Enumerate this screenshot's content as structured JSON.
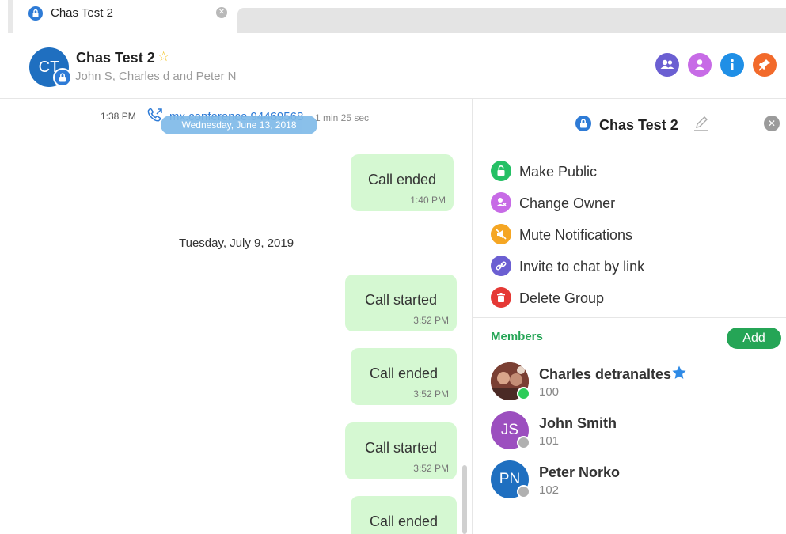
{
  "tab": {
    "title": "Chas Test 2",
    "close_glyph": "✕"
  },
  "header": {
    "avatar_initials": "CT",
    "title": "Chas Test 2",
    "star": "☆",
    "subtitle": "John S, Charles d and Peter N",
    "buttons": [
      {
        "icon": "people-icon",
        "color": "#6b5fd2"
      },
      {
        "icon": "phone-icon",
        "color": "#c76be6"
      },
      {
        "icon": "info-icon",
        "color": "#1f8fe6"
      },
      {
        "icon": "pin-icon",
        "color": "#f26a2b"
      }
    ]
  },
  "messages": {
    "call_time": "1:38 PM",
    "call_link": "mx.conference.94469568",
    "call_duration": "1 min 25 sec",
    "date_chip": "Wednesday, June 13, 2018",
    "date_separator": "Tuesday, July 9, 2019",
    "bubbles": [
      {
        "text": "Call ended",
        "time": "1:40 PM"
      },
      {
        "text": "Call started",
        "time": "3:52 PM"
      },
      {
        "text": "Call ended",
        "time": "3:52 PM"
      },
      {
        "text": "Call started",
        "time": "3:52 PM"
      },
      {
        "text": "Call ended",
        "time": ""
      }
    ]
  },
  "panel": {
    "title": "Chas Test 2",
    "actions": [
      {
        "label": "Make Public",
        "icon": "lock-open-icon",
        "color": "#25c065"
      },
      {
        "label": "Change Owner",
        "icon": "owner-icon",
        "color": "#c76be6"
      },
      {
        "label": "Mute Notifications",
        "icon": "mute-icon",
        "color": "#f5a623"
      },
      {
        "label": "Invite to chat by link",
        "icon": "link-icon",
        "color": "#6b5fd2"
      },
      {
        "label": "Delete Group",
        "icon": "trash-icon",
        "color": "#e53935"
      }
    ],
    "members_label": "Members",
    "add_label": "Add",
    "members": [
      {
        "name": "Charles detranaltes",
        "ext": "100",
        "initials": "",
        "avatar_color": "#8a4b3c",
        "status_color": "#2ecc5a",
        "starred": true
      },
      {
        "name": "John Smith",
        "ext": "101",
        "initials": "JS",
        "avatar_color": "#9c4fbf",
        "status_color": "#b0b0b0",
        "starred": false
      },
      {
        "name": "Peter Norko",
        "ext": "102",
        "initials": "PN",
        "avatar_color": "#1f6fc0",
        "status_color": "#b0b0b0",
        "starred": false
      }
    ]
  }
}
